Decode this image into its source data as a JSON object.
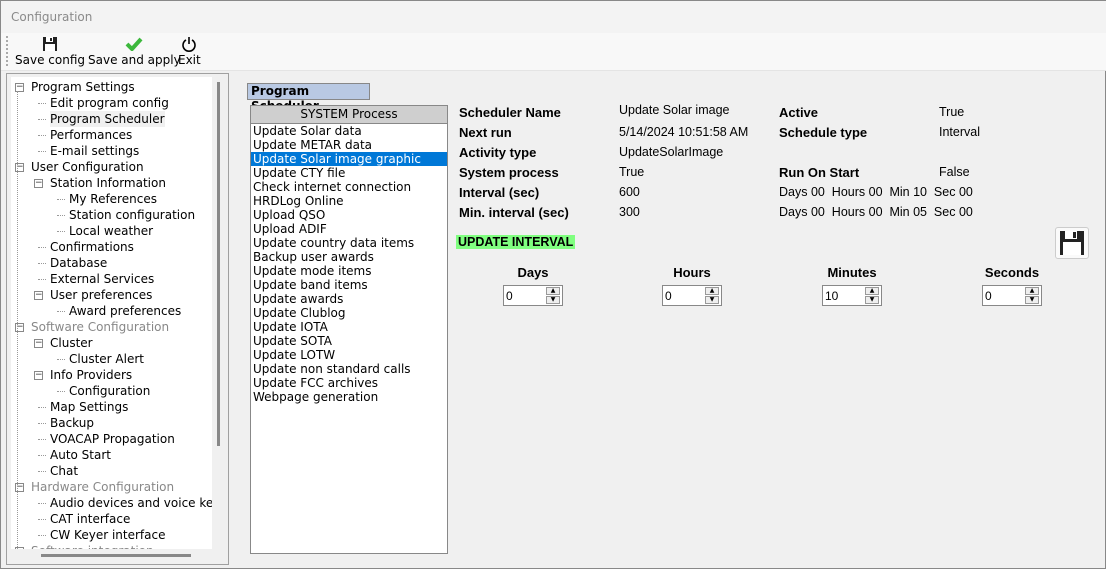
{
  "window": {
    "title": "Configuration"
  },
  "toolbar": {
    "save_config": "Save config",
    "save_apply": "Save and apply",
    "exit": "Exit"
  },
  "tree": [
    {
      "label": "Program Settings",
      "level": 0,
      "expander": true,
      "gray": false
    },
    {
      "label": "Edit program config",
      "level": 1
    },
    {
      "label": "Program Scheduler",
      "level": 1,
      "selected": true
    },
    {
      "label": "Performances",
      "level": 1
    },
    {
      "label": "E-mail settings",
      "level": 1
    },
    {
      "label": "User Configuration",
      "level": 0,
      "expander": true
    },
    {
      "label": "Station Information",
      "level": 1,
      "expander": true
    },
    {
      "label": "My References",
      "level": 2
    },
    {
      "label": "Station configuration",
      "level": 2
    },
    {
      "label": "Local weather",
      "level": 2
    },
    {
      "label": "Confirmations",
      "level": 1
    },
    {
      "label": "Database",
      "level": 1
    },
    {
      "label": "External Services",
      "level": 1
    },
    {
      "label": "User preferences",
      "level": 1,
      "expander": true
    },
    {
      "label": "Award preferences",
      "level": 2
    },
    {
      "label": "Software Configuration",
      "level": 0,
      "expander": true,
      "gray": true
    },
    {
      "label": "Cluster",
      "level": 1,
      "expander": true
    },
    {
      "label": "Cluster Alert",
      "level": 2
    },
    {
      "label": "Info Providers",
      "level": 1,
      "expander": true
    },
    {
      "label": "Configuration",
      "level": 2
    },
    {
      "label": "Map Settings",
      "level": 1
    },
    {
      "label": "Backup",
      "level": 1
    },
    {
      "label": "VOACAP Propagation",
      "level": 1
    },
    {
      "label": "Auto Start",
      "level": 1
    },
    {
      "label": "Chat",
      "level": 1
    },
    {
      "label": "Hardware Configuration",
      "level": 0,
      "expander": true,
      "gray": true
    },
    {
      "label": "Audio devices and voice keyer",
      "level": 1
    },
    {
      "label": "CAT interface",
      "level": 1
    },
    {
      "label": "CW Keyer interface",
      "level": 1
    },
    {
      "label": "Software integration",
      "level": 0,
      "expander": true,
      "gray": true
    }
  ],
  "main": {
    "section_title": "Program Scheduler",
    "list_header": "SYSTEM Process",
    "selected_index": 2,
    "list": [
      "Update Solar data",
      "Update METAR data",
      "Update Solar image graphic",
      "Update CTY file",
      "Check internet connection",
      "HRDLog Online",
      "Upload QSO",
      "Upload ADIF",
      "Update country data items",
      "Backup user awards",
      "Update mode items",
      "Update band items",
      "Update awards",
      "Update Clublog",
      "Update IOTA",
      "Update SOTA",
      "Update LOTW",
      "Update non standard calls",
      "Update FCC archives",
      "Webpage generation"
    ],
    "details": {
      "scheduler_name_label": "Scheduler Name",
      "scheduler_name": "Update Solar image",
      "next_run_label": "Next run",
      "next_run": "5/14/2024 10:51:58 AM",
      "activity_type_label": "Activity type",
      "activity_type": "UpdateSolarImage",
      "system_process_label": "System process",
      "system_process": "True",
      "interval_label": "Interval  (sec)",
      "interval": "600",
      "min_interval_label": "Min. interval  (sec)",
      "min_interval": "300",
      "active_label": "Active",
      "active": "True",
      "schedule_type_label": "Schedule type",
      "schedule_type": "Interval",
      "run_on_start_label": "Run On Start",
      "run_on_start": "False",
      "interval_breakdown": "Days 00  Hours 00  Min 10  Sec 00",
      "min_interval_breakdown": "Days 00  Hours 00  Min 05  Sec 00"
    },
    "update_interval_label": "UPDATE INTERVAL",
    "spinners": [
      {
        "label": "Days",
        "value": "0"
      },
      {
        "label": "Hours",
        "value": "0"
      },
      {
        "label": "Minutes",
        "value": "10"
      },
      {
        "label": "Seconds",
        "value": "0"
      }
    ]
  },
  "colors": {
    "selection": "#0078d7",
    "update_badge": "#80ff80",
    "section_title_bg": "#b9c9e3"
  }
}
